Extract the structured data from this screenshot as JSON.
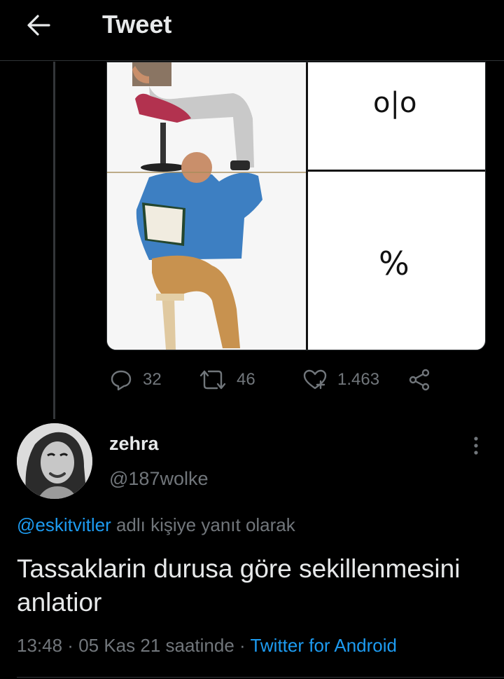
{
  "header": {
    "title": "Tweet",
    "back_icon": "arrow-left-icon"
  },
  "parent_tweet": {
    "meme_labels": [
      "o|o",
      "%"
    ],
    "stats": {
      "replies": "32",
      "retweets": "46",
      "likes": "1.463"
    }
  },
  "reply": {
    "display_name": "zehra",
    "handle": "@187wolke",
    "replying_to_handle": "@eskitvitler",
    "replying_to_suffix": " adlı kişiye yanıt olarak",
    "text": "Tassaklarin durusa göre sekillenmesini anlatior",
    "time": "13:48",
    "separator": " · ",
    "date": "05 Kas 21 saatinde",
    "source": "Twitter for Android"
  },
  "colors": {
    "background": "#000000",
    "text": "#e7e9ea",
    "muted": "#71767b",
    "accent": "#1d9bf0"
  }
}
